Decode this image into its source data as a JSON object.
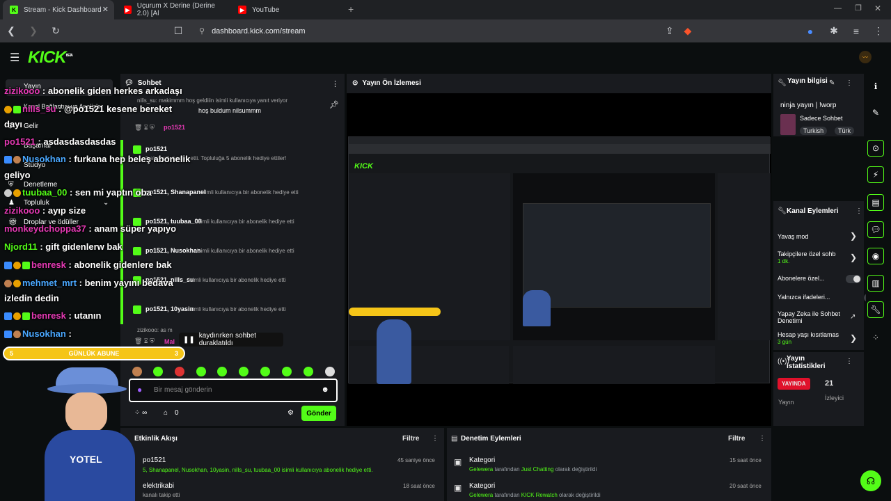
{
  "browser": {
    "tabs": [
      {
        "title": "Stream - Kick Dashboard",
        "icon": "kick-icon"
      },
      {
        "title": "Uçurum X Derine (Derine 2.0) [Al",
        "icon": "youtube-icon"
      },
      {
        "title": "YouTube",
        "icon": "youtube-icon"
      }
    ],
    "url": "dashboard.kick.com/stream"
  },
  "kick": {
    "logo": "KICK",
    "beta": "BETA"
  },
  "sidebar": {
    "items": [
      "Yayın",
      "Kanal Bağlantısı ve Analizler",
      "Gelir",
      "Başarılar",
      "Stüdyo",
      "Denetleme",
      "Topluluk",
      "Droplar ve ödüller"
    ]
  },
  "overlay_chat": [
    {
      "user": "zizikooo",
      "msg": ": abonelik giden herkes arkadaşı",
      "color": "#e63ab5"
    },
    {
      "user": "nills_su",
      "msg": ": @po1521 kesene bereket",
      "color": "#e63ab5"
    },
    {
      "user": "",
      "msg": "dayı",
      "color": "#fff"
    },
    {
      "user": "po1521",
      "msg": ": asdasdasdasdas",
      "color": "#e63ab5"
    },
    {
      "user": "Nusokhan",
      "msg": ": furkana hep beleş abonelik",
      "color": "#4aa8ff"
    },
    {
      "user": "",
      "msg": "geliyo",
      "color": "#fff"
    },
    {
      "user": "tuubaa_00",
      "msg": ": sen mi yaptın oba",
      "color": "#53fc18"
    },
    {
      "user": "zizikooo",
      "msg": ": ayıp size",
      "color": "#e63ab5"
    },
    {
      "user": "monkeydchoppa37",
      "msg": ": anam süper yapıyo",
      "color": "#e63ab5"
    },
    {
      "user": "Njord11",
      "msg": ": gift gidenlerw bak",
      "color": "#53fc18"
    },
    {
      "user": "benresk",
      "msg": ": abonelik gidenlere bak",
      "color": "#e63ab5"
    },
    {
      "user": "mehmet_mrt",
      "msg": ": benim yayını bedava",
      "color": "#4aa8ff"
    },
    {
      "user": "",
      "msg": "izledin dedin",
      "color": "#fff"
    },
    {
      "user": "benresk",
      "msg": ": utanın",
      "color": "#e63ab5"
    },
    {
      "user": "Nusokhan",
      "msg": ":",
      "color": "#4aa8ff"
    }
  ],
  "sub_goal": {
    "left": "5",
    "label": "GÜNLÜK ABUNE",
    "right": "3"
  },
  "chat": {
    "title": "Sohbet",
    "pinned": "nills_su: makimmm hoş geldiiin isimli kullanıcıya yanıt veriyor",
    "pinned2": "hoş buldum nilsummm",
    "user0": "po1521",
    "events": [
      {
        "user": "po1521",
        "text": "5 abonelik hediye etti. Topluluğa 5 abonelik hediye ettiler!"
      },
      {
        "user": "po1521, Shanapanel",
        "text": "isimli kullanıcıya bir abonelik hediye etti"
      },
      {
        "user": "po1521, tuubaa_00",
        "text": "isimli kullanıcıya bir abonelik hediye etti"
      },
      {
        "user": "po1521, Nusokhan",
        "text": "isimli kullanıcıya bir abonelik hediye etti"
      },
      {
        "user": "po1521, nills_su",
        "text": "isimli kullanıcıya bir abonelik hediye etti"
      },
      {
        "user": "po1521, 10yasin",
        "text": "isimli kullanıcıya bir abonelik hediye etti"
      }
    ],
    "paused": "kaydırırken sohbet duraklatıldı",
    "reply_hint": "zizikooo: as m",
    "mal": "Mal",
    "placeholder": "Bir mesaj gönderin",
    "count": "0",
    "send": "Gönder"
  },
  "preview": {
    "title": "Yayın Ön İzlemesi"
  },
  "stream_info": {
    "title": "Yayın bilgisi",
    "stream_title": "ninja yayın | !worp",
    "category": "Sadece Sohbet",
    "tags": [
      "Turkish",
      "Türk"
    ]
  },
  "channel_actions": {
    "title": "Kanal Eylemleri",
    "items": [
      {
        "label": "Yavaş mod",
        "type": "arrow"
      },
      {
        "label": "Takipçilere özel sohb",
        "sub": "1 dk.",
        "type": "arrow"
      },
      {
        "label": "Abonelere özel...",
        "type": "toggle"
      },
      {
        "label": "Yalnızca ifadeleri...",
        "type": "toggle"
      },
      {
        "label": "Yapay Zeka ile Sohbet Denetimi",
        "type": "ext"
      },
      {
        "label": "Hesap yaşı kısıtlamas",
        "sub": "3 gün",
        "type": "arrow"
      }
    ]
  },
  "stream_stats": {
    "title": "Yayın istatistikleri",
    "live": "YAYINDA",
    "live_label": "Yayın",
    "viewers": "21",
    "viewers_label": "İzleyici"
  },
  "activity": {
    "title": "Etkinlik Akışı",
    "filter": "Filtre",
    "items": [
      {
        "user": "po1521",
        "desc": "5, Shanapanel, Nusokhan, 10yasin, nills_su, tuubaa_00 isimli kullanıcıya abonelik hediye etti.",
        "time": "45 saniye önce"
      },
      {
        "user": "elektrikabi",
        "desc": "kanalı takip etti",
        "time": "18 saat önce"
      }
    ]
  },
  "moderation": {
    "title": "Denetim Eylemleri",
    "filter": "Filtre",
    "items": [
      {
        "title": "Kategori",
        "who": "Gelewera",
        "desc": "tarafından",
        "cat": "Just Chatting",
        "tail": "olarak değiştirildi",
        "time": "15 saat önce"
      },
      {
        "title": "Kategori",
        "who": "Gelewera",
        "desc": "tarafından",
        "cat": "KICK Rewatch",
        "tail": "olarak değiştirildi",
        "time": "20 saat önce"
      }
    ]
  }
}
